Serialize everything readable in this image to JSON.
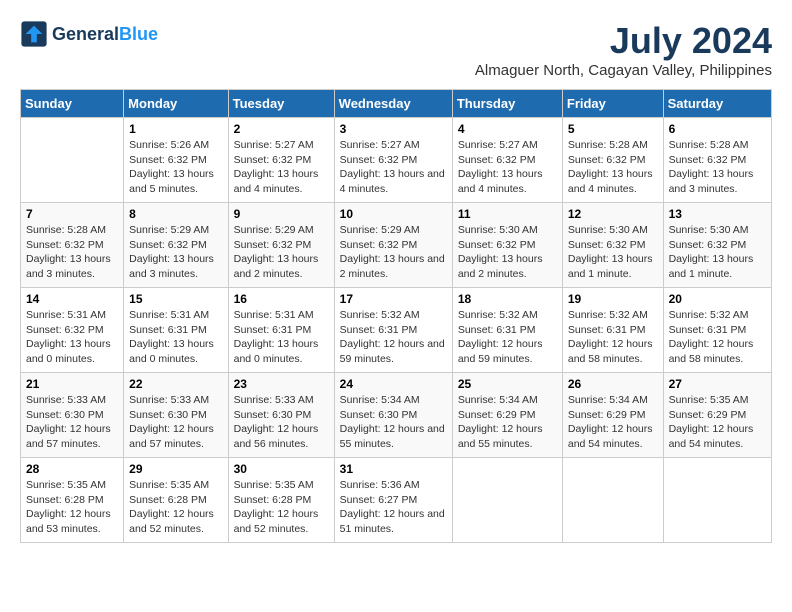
{
  "header": {
    "logo_line1": "General",
    "logo_line2": "Blue",
    "month_year": "July 2024",
    "location": "Almaguer North, Cagayan Valley, Philippines"
  },
  "weekdays": [
    "Sunday",
    "Monday",
    "Tuesday",
    "Wednesday",
    "Thursday",
    "Friday",
    "Saturday"
  ],
  "weeks": [
    [
      {
        "day": "",
        "sunrise": "",
        "sunset": "",
        "daylight": ""
      },
      {
        "day": "1",
        "sunrise": "Sunrise: 5:26 AM",
        "sunset": "Sunset: 6:32 PM",
        "daylight": "Daylight: 13 hours and 5 minutes."
      },
      {
        "day": "2",
        "sunrise": "Sunrise: 5:27 AM",
        "sunset": "Sunset: 6:32 PM",
        "daylight": "Daylight: 13 hours and 4 minutes."
      },
      {
        "day": "3",
        "sunrise": "Sunrise: 5:27 AM",
        "sunset": "Sunset: 6:32 PM",
        "daylight": "Daylight: 13 hours and 4 minutes."
      },
      {
        "day": "4",
        "sunrise": "Sunrise: 5:27 AM",
        "sunset": "Sunset: 6:32 PM",
        "daylight": "Daylight: 13 hours and 4 minutes."
      },
      {
        "day": "5",
        "sunrise": "Sunrise: 5:28 AM",
        "sunset": "Sunset: 6:32 PM",
        "daylight": "Daylight: 13 hours and 4 minutes."
      },
      {
        "day": "6",
        "sunrise": "Sunrise: 5:28 AM",
        "sunset": "Sunset: 6:32 PM",
        "daylight": "Daylight: 13 hours and 3 minutes."
      }
    ],
    [
      {
        "day": "7",
        "sunrise": "Sunrise: 5:28 AM",
        "sunset": "Sunset: 6:32 PM",
        "daylight": "Daylight: 13 hours and 3 minutes."
      },
      {
        "day": "8",
        "sunrise": "Sunrise: 5:29 AM",
        "sunset": "Sunset: 6:32 PM",
        "daylight": "Daylight: 13 hours and 3 minutes."
      },
      {
        "day": "9",
        "sunrise": "Sunrise: 5:29 AM",
        "sunset": "Sunset: 6:32 PM",
        "daylight": "Daylight: 13 hours and 2 minutes."
      },
      {
        "day": "10",
        "sunrise": "Sunrise: 5:29 AM",
        "sunset": "Sunset: 6:32 PM",
        "daylight": "Daylight: 13 hours and 2 minutes."
      },
      {
        "day": "11",
        "sunrise": "Sunrise: 5:30 AM",
        "sunset": "Sunset: 6:32 PM",
        "daylight": "Daylight: 13 hours and 2 minutes."
      },
      {
        "day": "12",
        "sunrise": "Sunrise: 5:30 AM",
        "sunset": "Sunset: 6:32 PM",
        "daylight": "Daylight: 13 hours and 1 minute."
      },
      {
        "day": "13",
        "sunrise": "Sunrise: 5:30 AM",
        "sunset": "Sunset: 6:32 PM",
        "daylight": "Daylight: 13 hours and 1 minute."
      }
    ],
    [
      {
        "day": "14",
        "sunrise": "Sunrise: 5:31 AM",
        "sunset": "Sunset: 6:32 PM",
        "daylight": "Daylight: 13 hours and 0 minutes."
      },
      {
        "day": "15",
        "sunrise": "Sunrise: 5:31 AM",
        "sunset": "Sunset: 6:31 PM",
        "daylight": "Daylight: 13 hours and 0 minutes."
      },
      {
        "day": "16",
        "sunrise": "Sunrise: 5:31 AM",
        "sunset": "Sunset: 6:31 PM",
        "daylight": "Daylight: 13 hours and 0 minutes."
      },
      {
        "day": "17",
        "sunrise": "Sunrise: 5:32 AM",
        "sunset": "Sunset: 6:31 PM",
        "daylight": "Daylight: 12 hours and 59 minutes."
      },
      {
        "day": "18",
        "sunrise": "Sunrise: 5:32 AM",
        "sunset": "Sunset: 6:31 PM",
        "daylight": "Daylight: 12 hours and 59 minutes."
      },
      {
        "day": "19",
        "sunrise": "Sunrise: 5:32 AM",
        "sunset": "Sunset: 6:31 PM",
        "daylight": "Daylight: 12 hours and 58 minutes."
      },
      {
        "day": "20",
        "sunrise": "Sunrise: 5:32 AM",
        "sunset": "Sunset: 6:31 PM",
        "daylight": "Daylight: 12 hours and 58 minutes."
      }
    ],
    [
      {
        "day": "21",
        "sunrise": "Sunrise: 5:33 AM",
        "sunset": "Sunset: 6:30 PM",
        "daylight": "Daylight: 12 hours and 57 minutes."
      },
      {
        "day": "22",
        "sunrise": "Sunrise: 5:33 AM",
        "sunset": "Sunset: 6:30 PM",
        "daylight": "Daylight: 12 hours and 57 minutes."
      },
      {
        "day": "23",
        "sunrise": "Sunrise: 5:33 AM",
        "sunset": "Sunset: 6:30 PM",
        "daylight": "Daylight: 12 hours and 56 minutes."
      },
      {
        "day": "24",
        "sunrise": "Sunrise: 5:34 AM",
        "sunset": "Sunset: 6:30 PM",
        "daylight": "Daylight: 12 hours and 55 minutes."
      },
      {
        "day": "25",
        "sunrise": "Sunrise: 5:34 AM",
        "sunset": "Sunset: 6:29 PM",
        "daylight": "Daylight: 12 hours and 55 minutes."
      },
      {
        "day": "26",
        "sunrise": "Sunrise: 5:34 AM",
        "sunset": "Sunset: 6:29 PM",
        "daylight": "Daylight: 12 hours and 54 minutes."
      },
      {
        "day": "27",
        "sunrise": "Sunrise: 5:35 AM",
        "sunset": "Sunset: 6:29 PM",
        "daylight": "Daylight: 12 hours and 54 minutes."
      }
    ],
    [
      {
        "day": "28",
        "sunrise": "Sunrise: 5:35 AM",
        "sunset": "Sunset: 6:28 PM",
        "daylight": "Daylight: 12 hours and 53 minutes."
      },
      {
        "day": "29",
        "sunrise": "Sunrise: 5:35 AM",
        "sunset": "Sunset: 6:28 PM",
        "daylight": "Daylight: 12 hours and 52 minutes."
      },
      {
        "day": "30",
        "sunrise": "Sunrise: 5:35 AM",
        "sunset": "Sunset: 6:28 PM",
        "daylight": "Daylight: 12 hours and 52 minutes."
      },
      {
        "day": "31",
        "sunrise": "Sunrise: 5:36 AM",
        "sunset": "Sunset: 6:27 PM",
        "daylight": "Daylight: 12 hours and 51 minutes."
      },
      {
        "day": "",
        "sunrise": "",
        "sunset": "",
        "daylight": ""
      },
      {
        "day": "",
        "sunrise": "",
        "sunset": "",
        "daylight": ""
      },
      {
        "day": "",
        "sunrise": "",
        "sunset": "",
        "daylight": ""
      }
    ]
  ]
}
